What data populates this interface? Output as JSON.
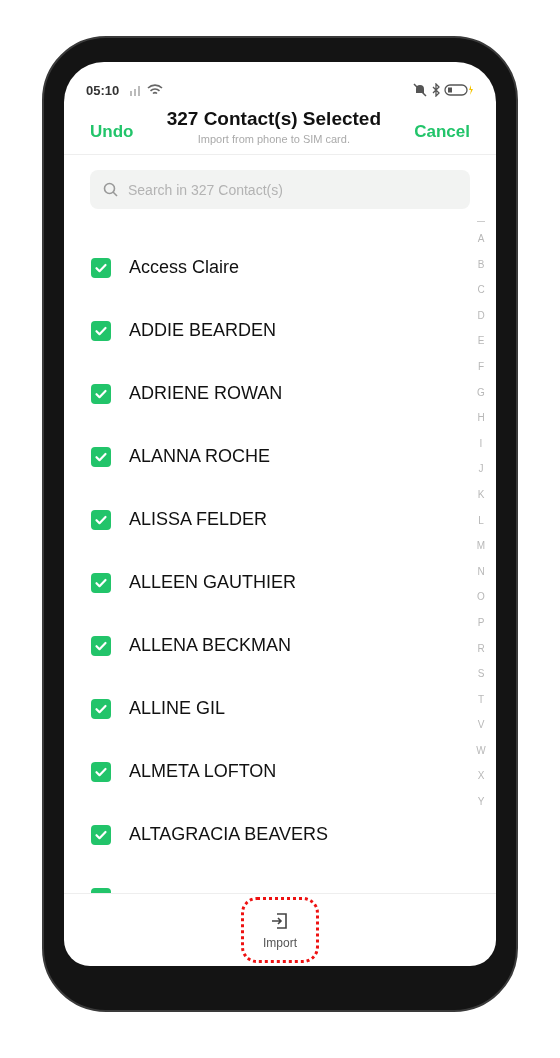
{
  "status_bar": {
    "time": "05:10"
  },
  "header": {
    "left_action": "Undo",
    "title": "327 Contact(s) Selected",
    "subtitle": "Import from phone to SIM card.",
    "right_action": "Cancel"
  },
  "search": {
    "placeholder": "Search in 327 Contact(s)"
  },
  "contacts": [
    {
      "name": "Access Claire",
      "checked": true
    },
    {
      "name": "ADDIE BEARDEN",
      "checked": true
    },
    {
      "name": "ADRIENE ROWAN",
      "checked": true
    },
    {
      "name": "ALANNA ROCHE",
      "checked": true
    },
    {
      "name": "ALISSA FELDER",
      "checked": true
    },
    {
      "name": "ALLEEN GAUTHIER",
      "checked": true
    },
    {
      "name": "ALLENA BECKMAN",
      "checked": true
    },
    {
      "name": "ALLINE GIL",
      "checked": true
    },
    {
      "name": "ALMETA LOFTON",
      "checked": true
    },
    {
      "name": "ALTAGRACIA BEAVERS",
      "checked": true
    },
    {
      "checked": true
    }
  ],
  "index": [
    "A",
    "B",
    "C",
    "D",
    "E",
    "F",
    "G",
    "H",
    "I",
    "J",
    "K",
    "L",
    "M",
    "N",
    "O",
    "P",
    "R",
    "S",
    "T",
    "V",
    "W",
    "X",
    "Y"
  ],
  "bottom_bar": {
    "actions": [
      {
        "label": "Import",
        "highlighted": true
      }
    ]
  }
}
